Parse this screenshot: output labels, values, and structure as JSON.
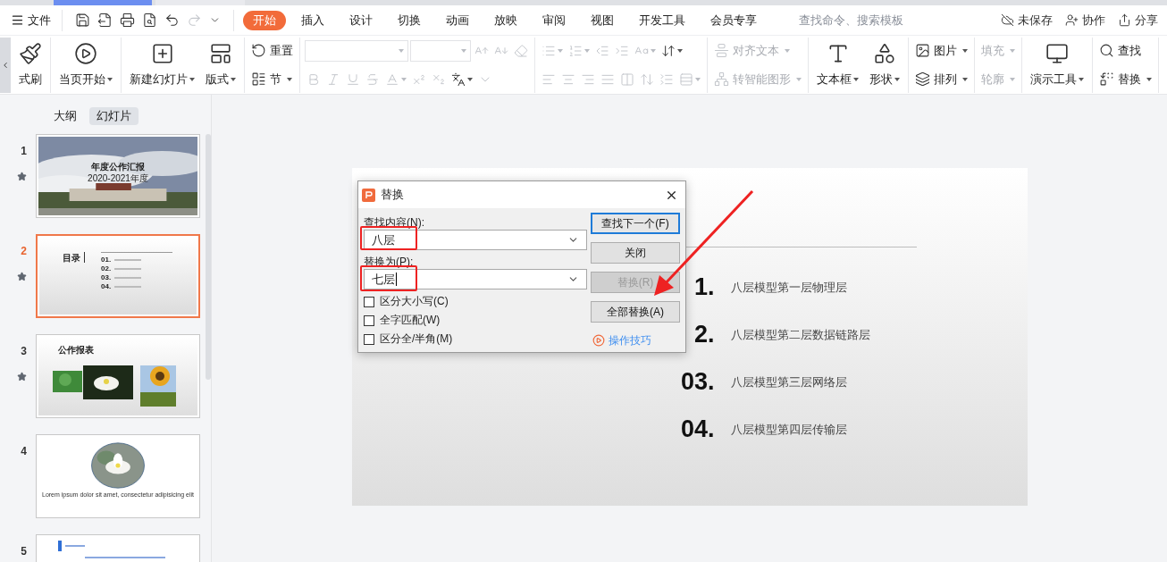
{
  "menu_bar": {
    "file": "文件",
    "quick_access": [
      {
        "kind": "save",
        "disabled": false
      },
      {
        "kind": "export",
        "disabled": false
      },
      {
        "kind": "print",
        "disabled": false
      },
      {
        "kind": "preview",
        "disabled": false
      },
      {
        "kind": "undo",
        "disabled": false
      },
      {
        "kind": "redo",
        "disabled": true
      },
      {
        "kind": "more",
        "disabled": false
      }
    ],
    "tabs": [
      {
        "label": "开始",
        "selected": true
      },
      {
        "label": "插入",
        "selected": false
      },
      {
        "label": "设计",
        "selected": false
      },
      {
        "label": "切换",
        "selected": false
      },
      {
        "label": "动画",
        "selected": false
      },
      {
        "label": "放映",
        "selected": false
      },
      {
        "label": "审阅",
        "selected": false
      },
      {
        "label": "视图",
        "selected": false
      },
      {
        "label": "开发工具",
        "selected": false
      },
      {
        "label": "会员专享",
        "selected": false
      }
    ],
    "search_placeholder": "查找命令、搜索模板",
    "actions": [
      {
        "kind": "cloud",
        "label": "未保存"
      },
      {
        "kind": "collab",
        "label": "协作"
      },
      {
        "kind": "share",
        "label": "分享"
      }
    ]
  },
  "toolbar": {
    "groups": [
      {
        "kind": "large",
        "items": [
          {
            "kind": "brush",
            "label": "式刷",
            "dropdown": false,
            "disabled": false
          }
        ]
      },
      {
        "kind": "large",
        "items": [
          {
            "kind": "play",
            "label": "当页开始",
            "dropdown": true,
            "disabled": false
          }
        ]
      },
      {
        "kind": "large",
        "items": [
          {
            "kind": "newslide",
            "label": "新建幻灯片",
            "dropdown": true,
            "disabled": false
          },
          {
            "kind": "layout",
            "label": "版式",
            "dropdown": true,
            "disabled": false
          }
        ]
      },
      {
        "kind": "stack",
        "items": [
          {
            "kind": "reset",
            "label": "重置",
            "dropdown": false,
            "disabled": false
          },
          {
            "kind": "section",
            "label": "节",
            "dropdown": true,
            "disabled": false
          }
        ]
      },
      {
        "kind": "rows",
        "rows": [
          [
            {
              "kind": "fontname",
              "disabled": true
            },
            {
              "kind": "fontsize",
              "disabled": true
            },
            {
              "kind": "grow",
              "disabled": true
            },
            {
              "kind": "shrink",
              "disabled": true
            },
            {
              "kind": "eraser",
              "disabled": true
            }
          ],
          [
            {
              "kind": "bold",
              "disabled": true
            },
            {
              "kind": "italic",
              "disabled": true
            },
            {
              "kind": "underline",
              "disabled": true
            },
            {
              "kind": "strike",
              "disabled": true
            },
            {
              "kind": "fontcolor",
              "dropdown": true,
              "disabled": true
            },
            {
              "kind": "superscript",
              "disabled": true
            },
            {
              "kind": "subscript",
              "disabled": true
            },
            {
              "kind": "phonetic",
              "dropdown": true,
              "disabled": false
            },
            {
              "kind": "caret",
              "disabled": true
            }
          ]
        ]
      },
      {
        "kind": "rows",
        "rows": [
          [
            {
              "kind": "bullets",
              "dropdown": true,
              "disabled": true
            },
            {
              "kind": "numbering",
              "dropdown": true,
              "disabled": true
            },
            {
              "kind": "outdent",
              "disabled": true
            },
            {
              "kind": "indent",
              "disabled": true
            },
            {
              "kind": "textdir",
              "dropdown": true,
              "disabled": true
            },
            {
              "kind": "sort",
              "dropdown": true,
              "disabled": false
            }
          ],
          [
            {
              "kind": "alignleft",
              "disabled": true
            },
            {
              "kind": "aligncenter",
              "disabled": true
            },
            {
              "kind": "alignright",
              "disabled": true
            },
            {
              "kind": "justify",
              "disabled": true
            },
            {
              "kind": "distribute",
              "disabled": true
            },
            {
              "kind": "spacing",
              "disabled": true
            },
            {
              "kind": "spacing2",
              "disabled": true
            },
            {
              "kind": "spacing3",
              "dropdown": true,
              "disabled": true
            }
          ]
        ]
      },
      {
        "kind": "stack",
        "items": [
          {
            "kind": "valign",
            "label": "对齐文本",
            "dropdown": true,
            "disabled": true
          },
          {
            "kind": "smartart",
            "label": "转智能图形",
            "dropdown": true,
            "disabled": true
          }
        ]
      },
      {
        "kind": "large",
        "items": [
          {
            "kind": "textbox",
            "label": "文本框",
            "dropdown": true,
            "disabled": false
          },
          {
            "kind": "shape",
            "label": "形状",
            "dropdown": true,
            "disabled": false
          }
        ]
      },
      {
        "kind": "stack",
        "items": [
          {
            "kind": "picture",
            "label": "图片",
            "dropdown": true,
            "disabled": false
          },
          {
            "kind": "arrange",
            "label": "排列",
            "dropdown": true,
            "disabled": false
          }
        ]
      },
      {
        "kind": "stack",
        "items": [
          {
            "kind": "none",
            "label": "填充",
            "dropdown": true,
            "disabled": true
          },
          {
            "kind": "none",
            "label": "轮廓",
            "dropdown": true,
            "disabled": true
          }
        ]
      },
      {
        "kind": "large",
        "items": [
          {
            "kind": "tools",
            "label": "演示工具",
            "dropdown": true,
            "disabled": false
          }
        ]
      },
      {
        "kind": "stack",
        "items": [
          {
            "kind": "find",
            "label": "查找",
            "dropdown": false,
            "disabled": false
          },
          {
            "kind": "replace",
            "label": "替换",
            "dropdown": true,
            "disabled": false
          }
        ]
      }
    ]
  },
  "panel": {
    "tabs": [
      {
        "label": "大纲",
        "selected": false
      },
      {
        "label": "幻灯片",
        "selected": true
      }
    ],
    "slides": [
      {
        "number": "1",
        "kind": "cover",
        "selected": false,
        "animated": true,
        "title": "年度公作汇报",
        "subtitle": "2020-2021年度"
      },
      {
        "number": "2",
        "kind": "contents",
        "selected": true,
        "animated": true,
        "title": "目录",
        "numbers": [
          "01.",
          "02.",
          "03.",
          "04."
        ]
      },
      {
        "number": "3",
        "kind": "gallery",
        "selected": false,
        "animated": true,
        "title": "公作报表"
      },
      {
        "number": "4",
        "kind": "circle",
        "selected": false,
        "animated": false,
        "caption": "Lorem ipsum dolor sit amet, consectetur adipisicing elit"
      },
      {
        "number": "5",
        "kind": "section",
        "selected": false,
        "animated": false
      }
    ]
  },
  "slide": {
    "items": [
      {
        "number": "1.",
        "text": "八层模型第一层物理层"
      },
      {
        "number": "2.",
        "text": "八层模型第二层数据链路层"
      },
      {
        "number": "03.",
        "text": "八层模型第三层网络层"
      },
      {
        "number": "04.",
        "text": "八层模型第四层传输层"
      }
    ]
  },
  "dialog": {
    "title": "替换",
    "find_label": "查找内容(N):",
    "find_value": "八层",
    "replace_label": "替换为(P):",
    "replace_value": "七层",
    "options": [
      {
        "label": "区分大小写(C)",
        "checked": false
      },
      {
        "label": "全字匹配(W)",
        "checked": false
      },
      {
        "label": "区分全/半角(M)",
        "checked": false
      }
    ],
    "buttons": [
      {
        "label": "查找下一个(F)",
        "default": true,
        "disabled": false
      },
      {
        "label": "关闭",
        "default": false,
        "disabled": false
      },
      {
        "label": "替换(R)",
        "default": false,
        "disabled": true
      },
      {
        "label": "全部替换(A)",
        "default": false,
        "disabled": false
      }
    ],
    "tips_link": "操作技巧"
  }
}
